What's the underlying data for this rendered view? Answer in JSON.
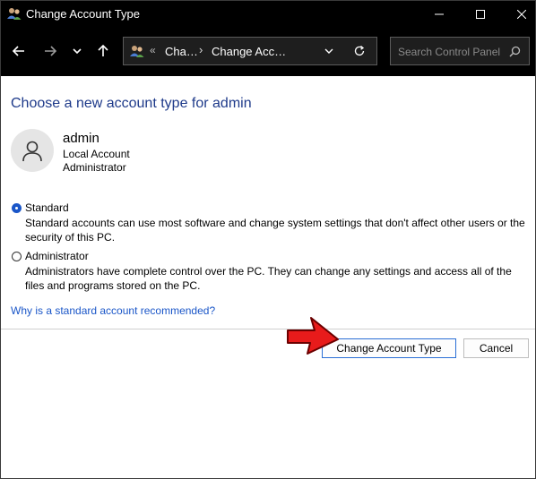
{
  "window": {
    "title": "Change Account Type"
  },
  "address_bar": {
    "separator": "«",
    "crumbs": [
      "Cha…",
      "Change Acc…"
    ]
  },
  "search": {
    "placeholder": "Search Control Panel"
  },
  "page": {
    "heading": "Choose a new account type for admin",
    "account": {
      "name": "admin",
      "type": "Local Account",
      "role": "Administrator"
    },
    "options": [
      {
        "label": "Standard",
        "description": "Standard accounts can use most software and change system settings that don't affect other users or the security of this PC.",
        "selected": true
      },
      {
        "label": "Administrator",
        "description": "Administrators have complete control over the PC. They can change any settings and access all of the files and programs stored on the PC.",
        "selected": false
      }
    ],
    "help_link": "Why is a standard account recommended?"
  },
  "buttons": {
    "primary": "Change Account Type",
    "cancel": "Cancel"
  },
  "colors": {
    "accent": "#1a56c8",
    "heading": "#1e3a8a",
    "annotation_arrow": "#e81b1b"
  }
}
